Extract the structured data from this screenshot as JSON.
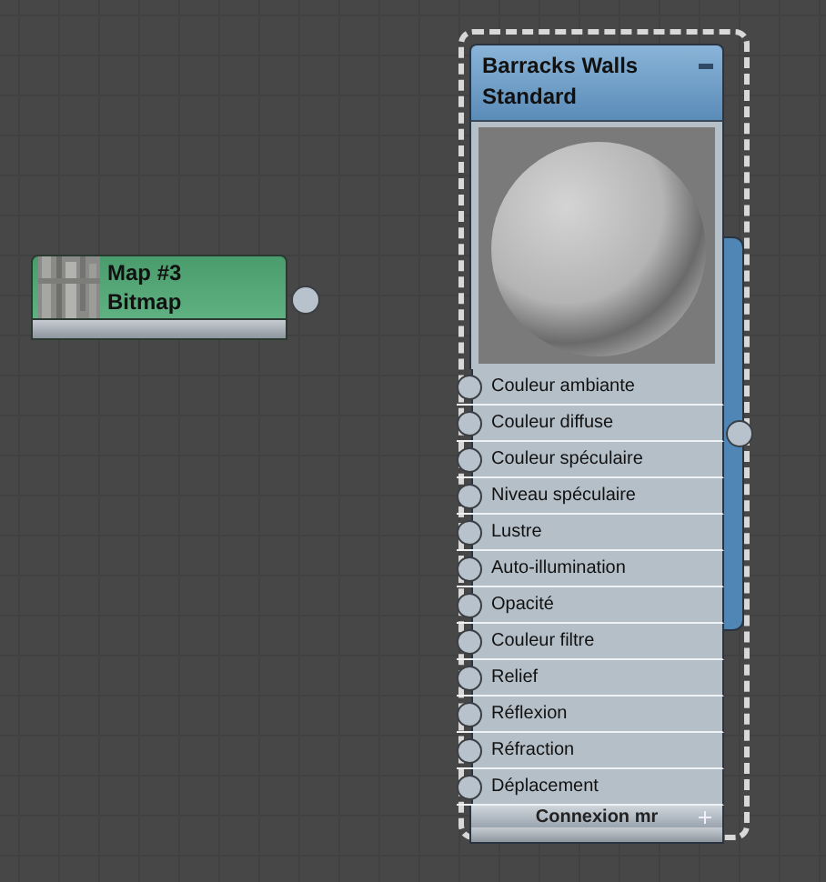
{
  "map_node": {
    "title": "Map #3",
    "subtitle": "Bitmap"
  },
  "material_node": {
    "title": "Barracks Walls",
    "subtitle": "Standard",
    "selected": true,
    "slots": [
      {
        "label": "Couleur ambiante"
      },
      {
        "label": "Couleur diffuse"
      },
      {
        "label": "Couleur spéculaire"
      },
      {
        "label": "Niveau spéculaire"
      },
      {
        "label": "Lustre"
      },
      {
        "label": "Auto-illumination"
      },
      {
        "label": "Opacité"
      },
      {
        "label": "Couleur filtre"
      },
      {
        "label": "Relief"
      },
      {
        "label": "Réflexion"
      },
      {
        "label": "Réfraction"
      },
      {
        "label": "Déplacement"
      }
    ],
    "footer": "Connexion mr"
  }
}
